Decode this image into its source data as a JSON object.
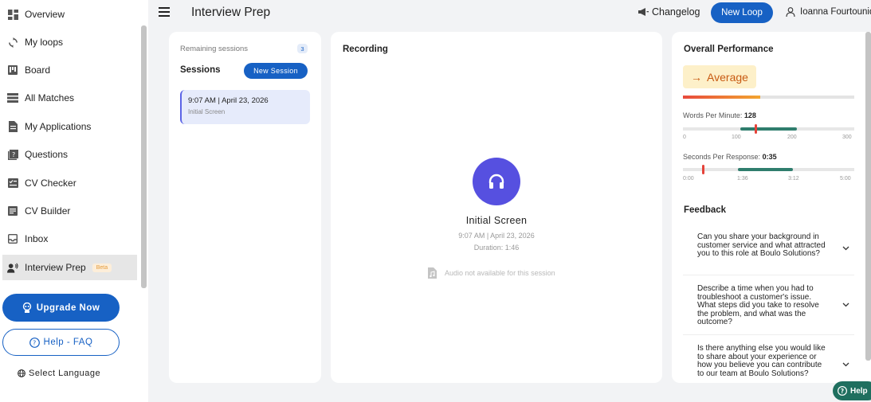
{
  "sidebar": {
    "items": [
      {
        "label": "Overview",
        "icon": "grid-icon"
      },
      {
        "label": "My loops",
        "icon": "loop-icon"
      },
      {
        "label": "Board",
        "icon": "board-icon"
      },
      {
        "label": "All Matches",
        "icon": "list-icon"
      },
      {
        "label": "My Applications",
        "icon": "document-icon"
      },
      {
        "label": "Questions",
        "icon": "question-icon"
      },
      {
        "label": "CV Checker",
        "icon": "checklist-icon"
      },
      {
        "label": "CV Builder",
        "icon": "builder-icon"
      },
      {
        "label": "Inbox",
        "icon": "inbox-icon"
      },
      {
        "label": "Interview Prep",
        "icon": "interview-icon",
        "badge": "Beta",
        "active": true
      }
    ],
    "upgrade_label": "Upgrade Now",
    "faq_label": "Help - FAQ",
    "language_label": "Select Language"
  },
  "header": {
    "title": "Interview Prep",
    "changelog_label": "Changelog",
    "new_loop_label": "New Loop",
    "user_name": "Ioanna Fourtounidou"
  },
  "sessions": {
    "remaining_label": "Remaining sessions",
    "remaining_count": "3",
    "title": "Sessions",
    "new_session_label": "New Session",
    "items": [
      {
        "time": "9:07 AM | April 23, 2026",
        "type": "Initial Screen"
      }
    ]
  },
  "recording": {
    "title": "Recording",
    "name": "Initial Screen",
    "date": "9:07 AM | April 23, 2026",
    "duration": "Duration: 1:46",
    "audio_note": "Audio not available for this session"
  },
  "performance": {
    "title": "Overall Performance",
    "rating": "Average",
    "rating_arrow": "→",
    "overall_fraction": 0.45,
    "wpm": {
      "label": "Words Per Minute:",
      "value": "128",
      "ticks": [
        "0",
        "100",
        "200",
        "300"
      ],
      "axis_min": 0,
      "axis_max": 300,
      "value_num": 128,
      "range_min": 100,
      "range_max": 200
    },
    "spr": {
      "label": "Seconds Per Response:",
      "value": "0:35",
      "ticks": [
        "0:00",
        "1:36",
        "3:12",
        "5:00"
      ],
      "axis_min": 0,
      "axis_max": 300,
      "value_num": 35,
      "range_min": 96,
      "range_max": 192
    },
    "feedback_title": "Feedback",
    "feedback": [
      "Can you share your background in customer service and what attracted you to this role at Boulo Solutions?",
      "Describe a time when you had to troubleshoot a customer's issue. What steps did you take to resolve the problem, and what was the outcome?",
      "Is there anything else you would like to share about your experience or how you believe you can contribute to our team at Boulo Solutions?"
    ]
  },
  "help_label": "Help",
  "colors": {
    "primary": "#1761c4",
    "accent_purple": "#5650e0",
    "range_green": "#2f7d6d",
    "marker_red": "#e5433a",
    "rating_bg": "#fdf0c9",
    "rating_text": "#c85a12"
  }
}
